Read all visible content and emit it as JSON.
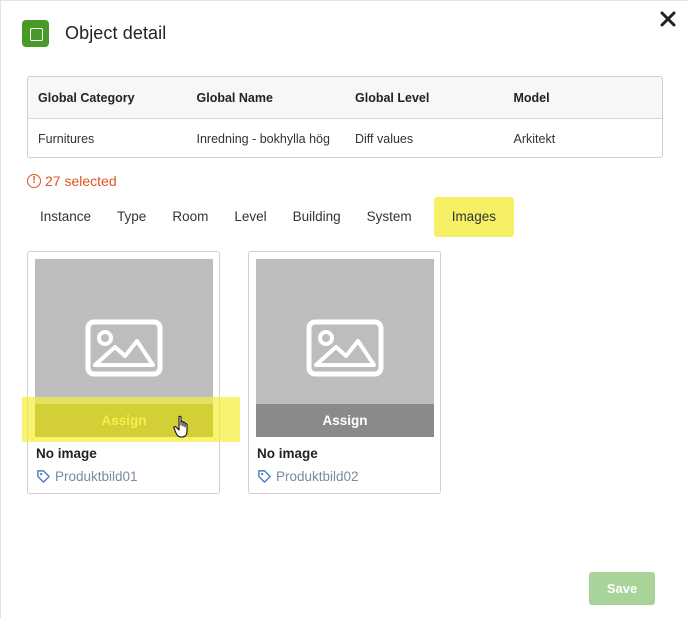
{
  "dialog": {
    "title": "Object detail",
    "close_icon": "close-icon",
    "object_icon": "object-square-icon",
    "accent": "#4a9a2a"
  },
  "info_table": {
    "headers": [
      "Global Category",
      "Global Name",
      "Global Level",
      "Model"
    ],
    "values": [
      "Furnitures",
      "Inredning - bokhylla hög",
      "Diff values",
      "Arkitekt"
    ]
  },
  "selection": {
    "text": "27 selected",
    "icon": "warning-circle-icon",
    "color": "#e0541f"
  },
  "tabs": [
    {
      "label": "Instance"
    },
    {
      "label": "Type"
    },
    {
      "label": "Room"
    },
    {
      "label": "Level"
    },
    {
      "label": "Building"
    },
    {
      "label": "System"
    },
    {
      "label": "Images",
      "active": true
    }
  ],
  "cards": [
    {
      "assign_label": "Assign",
      "status": "No image",
      "tag": "Produktbild01"
    },
    {
      "assign_label": "Assign",
      "status": "No image",
      "tag": "Produktbild02"
    }
  ],
  "footer": {
    "save_label": "Save",
    "save_color": "#a8d49a"
  },
  "highlight_color": "#f5f064"
}
